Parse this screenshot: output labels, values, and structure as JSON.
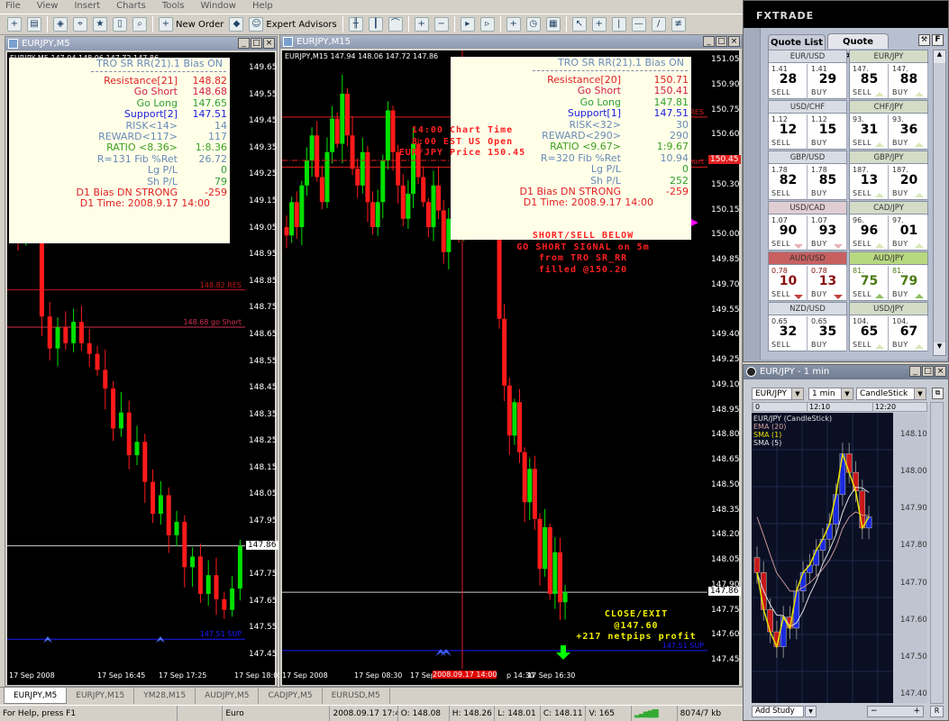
{
  "menu": [
    "File",
    "View",
    "Insert",
    "Charts",
    "Tools",
    "Window",
    "Help"
  ],
  "toolbar": {
    "new_order": "New Order",
    "expert_advisors": "Expert Advisors"
  },
  "left_chart": {
    "window_title": "EURJPY,M5",
    "header": "EURJPY,M5  147.94 148.06 147.72 147.86",
    "panel_title": "TRO SR RR(21).1  Bias ON",
    "rows": [
      {
        "label": "Resistance[21]",
        "value": "148.82",
        "color": "red"
      },
      {
        "label": "Go Short",
        "value": "148.68",
        "color": "pink"
      },
      {
        "label": "Go Long",
        "value": "147.65",
        "color": "grn"
      },
      {
        "label": "Support[2]",
        "value": "147.51",
        "color": "blu"
      },
      {
        "label": "RISK<14>",
        "value": "14",
        "color": "gry"
      },
      {
        "label": "REWARD<117>",
        "value": "117",
        "color": "gry"
      },
      {
        "label": "RATIO <8.36>",
        "value": "1:8.36",
        "color": "dgrn"
      },
      {
        "label": "R=131 Fib %Ret",
        "value": "26.72",
        "color": "gry"
      },
      {
        "label": "Lg P/L",
        "value": "0",
        "color": "gry",
        "vcolor": "grn"
      },
      {
        "label": "Sh P/L",
        "value": "79",
        "color": "gry",
        "vcolor": "grn"
      },
      {
        "label": "D1 Bias DN STRONG",
        "value": "-259",
        "color": "red"
      }
    ],
    "d1_time": "D1 Time: 2008.9.17 14:00",
    "price_labels": [
      "149.65",
      "149.55",
      "149.45",
      "149.35",
      "149.25",
      "149.15",
      "149.05",
      "148.95",
      "148.85",
      "148.75",
      "148.65",
      "148.55",
      "148.45",
      "148.35",
      "148.25",
      "148.15",
      "148.05",
      "147.95",
      "147.85",
      "147.75",
      "147.65",
      "147.55",
      "147.45"
    ],
    "price_range": [
      147.45,
      149.65
    ],
    "lines": [
      {
        "price": 148.82,
        "label": "148.82 RES",
        "color": "#c01818"
      },
      {
        "price": 148.68,
        "label": "148.68 go Short",
        "color": "#d03050"
      },
      {
        "price": 147.51,
        "label": "147.51 SUP",
        "color": "#1a1aff"
      }
    ],
    "current_price": "147.86",
    "time_labels": [
      "17 Sep 2008",
      "17 Sep 16:45",
      "17 Sep 17:25",
      "17 Sep 18:05"
    ],
    "closes": [
      149.02,
      149.1,
      149.52,
      148.72,
      148.6,
      148.68,
      148.62,
      148.7,
      148.62,
      148.58,
      148.52,
      148.45,
      148.3,
      148.36,
      148.2,
      148.25,
      148.1,
      147.98,
      148.05,
      147.9,
      147.95,
      147.78,
      147.82,
      147.68,
      147.75,
      147.66,
      147.62,
      147.7,
      147.86
    ]
  },
  "mid_chart": {
    "window_title": "EURJPY,M15",
    "header": "EURJPY,M15  147.94 148.06 147.72 147.86",
    "panel_title": "TRO SR RR(21).1  Bias ON",
    "rows": [
      {
        "label": "Resistance[20]",
        "value": "150.71",
        "color": "red"
      },
      {
        "label": "Go Short",
        "value": "150.41",
        "color": "pink"
      },
      {
        "label": "Go Long",
        "value": "147.81",
        "color": "grn"
      },
      {
        "label": "Support[1]",
        "value": "147.51",
        "color": "blu"
      },
      {
        "label": "RISK<32>",
        "value": "30",
        "color": "gry"
      },
      {
        "label": "REWARD<290>",
        "value": "290",
        "color": "gry"
      },
      {
        "label": "RATIO <9.67>",
        "value": "1:9.67",
        "color": "dgrn"
      },
      {
        "label": "R=320 Fib %Ret",
        "value": "10.94",
        "color": "gry"
      },
      {
        "label": "Lg P/L",
        "value": "0",
        "color": "gry",
        "vcolor": "grn"
      },
      {
        "label": "Sh P/L",
        "value": "252",
        "color": "gry",
        "vcolor": "grn"
      },
      {
        "label": "D1 Bias DN STRONG",
        "value": "-259",
        "color": "red"
      }
    ],
    "d1_time": "D1 Time: 2008.9.17 14:00",
    "price_labels": [
      "151.05",
      "150.90",
      "150.75",
      "150.60",
      "150.45",
      "150.30",
      "150.15",
      "150.00",
      "149.85",
      "149.70",
      "149.55",
      "149.40",
      "149.25",
      "149.10",
      "148.95",
      "148.80",
      "148.65",
      "148.50",
      "148.35",
      "148.20",
      "148.05",
      "147.90",
      "147.75",
      "147.60",
      "147.45"
    ],
    "price_range": [
      147.45,
      151.05
    ],
    "lines": [
      {
        "price": 150.71,
        "label": "150.71 RES",
        "color": "#e02020"
      },
      {
        "price": 150.41,
        "label": "150.41 go Short",
        "color": "#e02020"
      },
      {
        "price": 147.51,
        "label": "147.51 SUP",
        "color": "#1a1aff"
      }
    ],
    "marker_price": "150.45",
    "current_price": "147.86",
    "time_labels": [
      "17 Sep 2008",
      "17 Sep 08:30",
      "17 Sep 10:30",
      "2008.09.17 14:00",
      "p 14:30",
      "17 Sep 16:30"
    ],
    "annotation_time": [
      "14:00 Chart Time",
      "8:00 EST US Open",
      "EUR/JPY Price 150.45"
    ],
    "annotation_short": [
      "SHORT/SELL BELOW",
      "GO SHORT SIGNAL on 5m",
      "from TRO SR_RR",
      "filled @150.20"
    ],
    "annotation_exit": [
      "CLOSE/EXIT",
      "@147.60",
      "+217 netpips profit"
    ],
    "closes": [
      150.0,
      150.2,
      150.05,
      150.3,
      150.45,
      150.6,
      150.35,
      150.2,
      150.5,
      150.7,
      150.55,
      150.85,
      150.6,
      150.4,
      150.3,
      150.5,
      150.2,
      150.05,
      150.2,
      150.45,
      150.75,
      150.5,
      150.3,
      150.1,
      150.25,
      150.55,
      150.35,
      150.2,
      150.05,
      150.3,
      150.15,
      149.9,
      150.1,
      150.3,
      150.0,
      150.2,
      150.55,
      150.3,
      150.4,
      150.15,
      150.35,
      150.2,
      149.5,
      149.1,
      148.8,
      149.0,
      148.7,
      148.4,
      148.6,
      148.3,
      148.0,
      148.25,
      147.85,
      148.1,
      147.8,
      147.86
    ]
  },
  "tabs": [
    "EURJPY,M5",
    "EURJPY,M15",
    "YM28,M15",
    "AUDJPY,M5",
    "CADJPY,M5",
    "EURUSD,M5"
  ],
  "status": {
    "help": "For Help, press F1",
    "profile": "Euro",
    "datetime": "2008.09.17 17:45",
    "open": "O: 148.08",
    "high": "H: 148.26",
    "low": "L: 148.01",
    "close": "C: 148.11",
    "volume": "V: 165",
    "traffic": "8074/7 kb"
  },
  "fxtrade": {
    "brand": "FXTRADE",
    "tabs": [
      "Quote List",
      "Quote Panel"
    ],
    "pairs": [
      {
        "name": "EUR/USD",
        "sell_pre": "1.41",
        "sell": "28",
        "buy_pre": "1.41",
        "buy": "29",
        "trend": "none"
      },
      {
        "name": "EUR/JPY",
        "sell_pre": "147.",
        "sell": "85",
        "buy_pre": "147.",
        "buy": "88",
        "trend": "up"
      },
      {
        "name": "USD/CHF",
        "sell_pre": "1.12",
        "sell": "12",
        "buy_pre": "1.12",
        "buy": "15",
        "trend": "none"
      },
      {
        "name": "CHF/JPY",
        "sell_pre": "93.",
        "sell": "31",
        "buy_pre": "93.",
        "buy": "36",
        "trend": "up"
      },
      {
        "name": "GBP/USD",
        "sell_pre": "1.78",
        "sell": "82",
        "buy_pre": "1.78",
        "buy": "85",
        "trend": "none"
      },
      {
        "name": "GBP/JPY",
        "sell_pre": "187.",
        "sell": "13",
        "buy_pre": "187.",
        "buy": "20",
        "trend": "up"
      },
      {
        "name": "USD/CAD",
        "sell_pre": "1.07",
        "sell": "90",
        "buy_pre": "1.07",
        "buy": "93",
        "trend": "down"
      },
      {
        "name": "CAD/JPY",
        "sell_pre": "96.",
        "sell": "96",
        "buy_pre": "97.",
        "buy": "01",
        "trend": "up"
      },
      {
        "name": "AUD/USD",
        "sell_pre": "0.78",
        "sell": "10",
        "buy_pre": "0.78",
        "buy": "13",
        "trend": "down-strong"
      },
      {
        "name": "AUD/JPY",
        "sell_pre": "81.",
        "sell": "75",
        "buy_pre": "81.",
        "buy": "79",
        "trend": "up-strong"
      },
      {
        "name": "NZD/USD",
        "sell_pre": "0.65",
        "sell": "32",
        "buy_pre": "0.65",
        "buy": "35",
        "trend": "none"
      },
      {
        "name": "USD/JPY",
        "sell_pre": "104.",
        "sell": "65",
        "buy_pre": "104.",
        "buy": "67",
        "trend": "up"
      }
    ],
    "sell_label": "SELL",
    "buy_label": "BUY"
  },
  "mini_chart": {
    "title": "EUR/JPY - 1 min",
    "instrument": "EUR/JPY",
    "interval": "1 min",
    "style": "CandleStick",
    "time_labels": [
      "0",
      "12:10",
      "12:20"
    ],
    "legend": [
      {
        "text": "EUR/JPY (CandleStick)",
        "color": "#e0e0e0"
      },
      {
        "text": "EMA (20)",
        "color": "#d8a0a0"
      },
      {
        "text": "SMA (1)",
        "color": "#e8e000"
      },
      {
        "text": "SMA (5)",
        "color": "#e0e0e0"
      }
    ],
    "price_labels": [
      "148.10",
      "148.00",
      "147.90",
      "147.80",
      "147.70",
      "147.60",
      "147.50",
      "147.40"
    ],
    "price_range": [
      147.4,
      148.1
    ],
    "closes": [
      147.73,
      147.63,
      147.57,
      147.53,
      147.61,
      147.58,
      147.68,
      147.73,
      147.75,
      147.79,
      147.82,
      147.86,
      147.94,
      148.05,
      148.0,
      147.95,
      147.85,
      147.88
    ],
    "add_study": "Add Study"
  }
}
